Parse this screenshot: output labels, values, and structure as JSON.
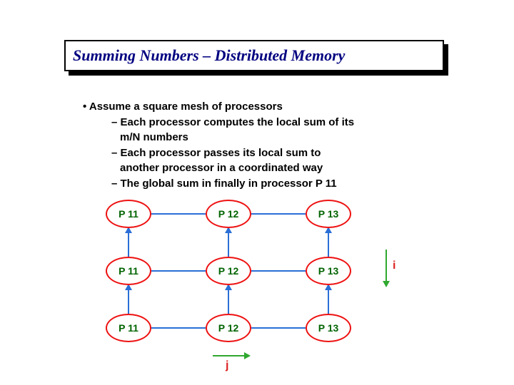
{
  "title": "Summing Numbers – Distributed Memory",
  "bullets": {
    "b1": "• Assume a square mesh of processors",
    "b2a": "– Each processor computes the local sum of its",
    "b2a_cont": "m/N numbers",
    "b2b": "– Each processor passes its local sum to",
    "b2b_cont": "another processor in a coordinated way",
    "b2c": "– The global sum in finally in processor P 11"
  },
  "mesh": {
    "rows": [
      [
        "P 11",
        "P 12",
        "P 13"
      ],
      [
        "P 11",
        "P 12",
        "P 13"
      ],
      [
        "P 11",
        "P 12",
        "P 13"
      ]
    ]
  },
  "axes": {
    "i": "i",
    "j": "j"
  },
  "chart_data": {
    "type": "mesh-diagram",
    "grid_rows": 3,
    "grid_cols": 3,
    "node_labels": [
      [
        "P 11",
        "P 12",
        "P 13"
      ],
      [
        "P 11",
        "P 12",
        "P 13"
      ],
      [
        "P 11",
        "P 12",
        "P 13"
      ]
    ],
    "horizontal_edges": true,
    "vertical_arrows_direction": "up",
    "row_axis_label": "i",
    "col_axis_label": "j"
  }
}
